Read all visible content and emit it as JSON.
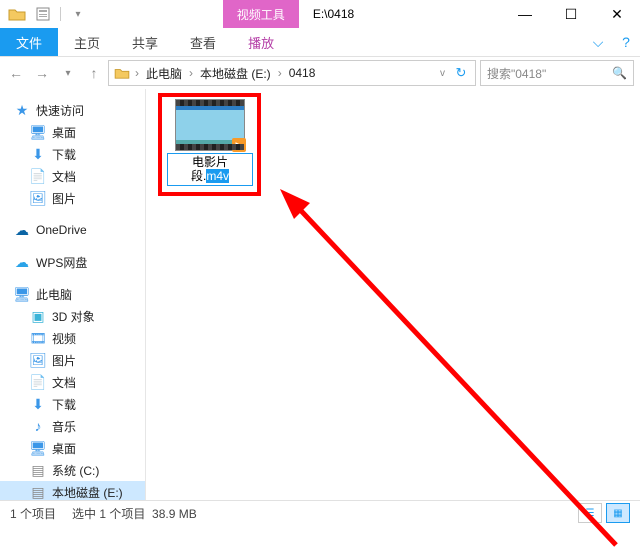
{
  "titlebar": {
    "context_tab": "视频工具",
    "title": "E:\\0418",
    "min": "—",
    "max": "☐",
    "close": "✕"
  },
  "ribbon": {
    "file": "文件",
    "home": "主页",
    "share": "共享",
    "view": "查看",
    "play": "播放"
  },
  "address": {
    "seg1": "此电脑",
    "seg2": "本地磁盘 (E:)",
    "seg3": "0418",
    "sep": "›"
  },
  "search": {
    "placeholder": "搜索\"0418\""
  },
  "sidebar": {
    "quick": "快速访问",
    "desktop": "桌面",
    "downloads": "下载",
    "documents": "文档",
    "pictures": "图片",
    "onedrive": "OneDrive",
    "wps": "WPS网盘",
    "thispc": "此电脑",
    "obj3d": "3D 对象",
    "videos": "视频",
    "pictures2": "图片",
    "documents2": "文档",
    "downloads2": "下载",
    "music": "音乐",
    "desktop2": "桌面",
    "cdrive": "系统 (C:)",
    "edrive": "本地磁盘 (E:)"
  },
  "file": {
    "name_line1": "电影片",
    "name_line2a": "段.",
    "name_line2b_sel": "m4v"
  },
  "status": {
    "items": "1 个项目",
    "selected": "选中 1 个项目",
    "size": "38.9 MB"
  }
}
